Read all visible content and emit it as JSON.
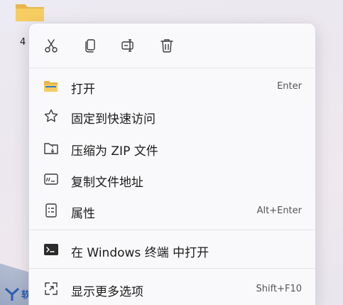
{
  "desktop": {
    "folder_caption": "4",
    "brand_text": "软"
  },
  "toolbar": {
    "cut_icon": "scissors-icon",
    "copy_icon": "copy-icon",
    "rename_icon": "rename-icon",
    "delete_icon": "trash-icon"
  },
  "menu": {
    "items": [
      {
        "icon": "folder-open-icon",
        "label": "打开",
        "shortcut": "Enter"
      },
      {
        "icon": "star-icon",
        "label": "固定到快速访问",
        "shortcut": ""
      },
      {
        "icon": "zip-folder-icon",
        "label": "压缩为 ZIP 文件",
        "shortcut": ""
      },
      {
        "icon": "copy-path-icon",
        "label": "复制文件地址",
        "shortcut": ""
      },
      {
        "icon": "properties-icon",
        "label": "属性",
        "shortcut": "Alt+Enter"
      },
      {
        "icon": "terminal-icon",
        "label": "在 Windows 终端 中打开",
        "shortcut": ""
      },
      {
        "icon": "more-options-icon",
        "label": "显示更多选项",
        "shortcut": "Shift+F10"
      }
    ]
  },
  "colors": {
    "icon_stroke": "#3a3a3a",
    "folder_yellow": "#e8b64a",
    "menu_bg": "#f9f9fb"
  }
}
